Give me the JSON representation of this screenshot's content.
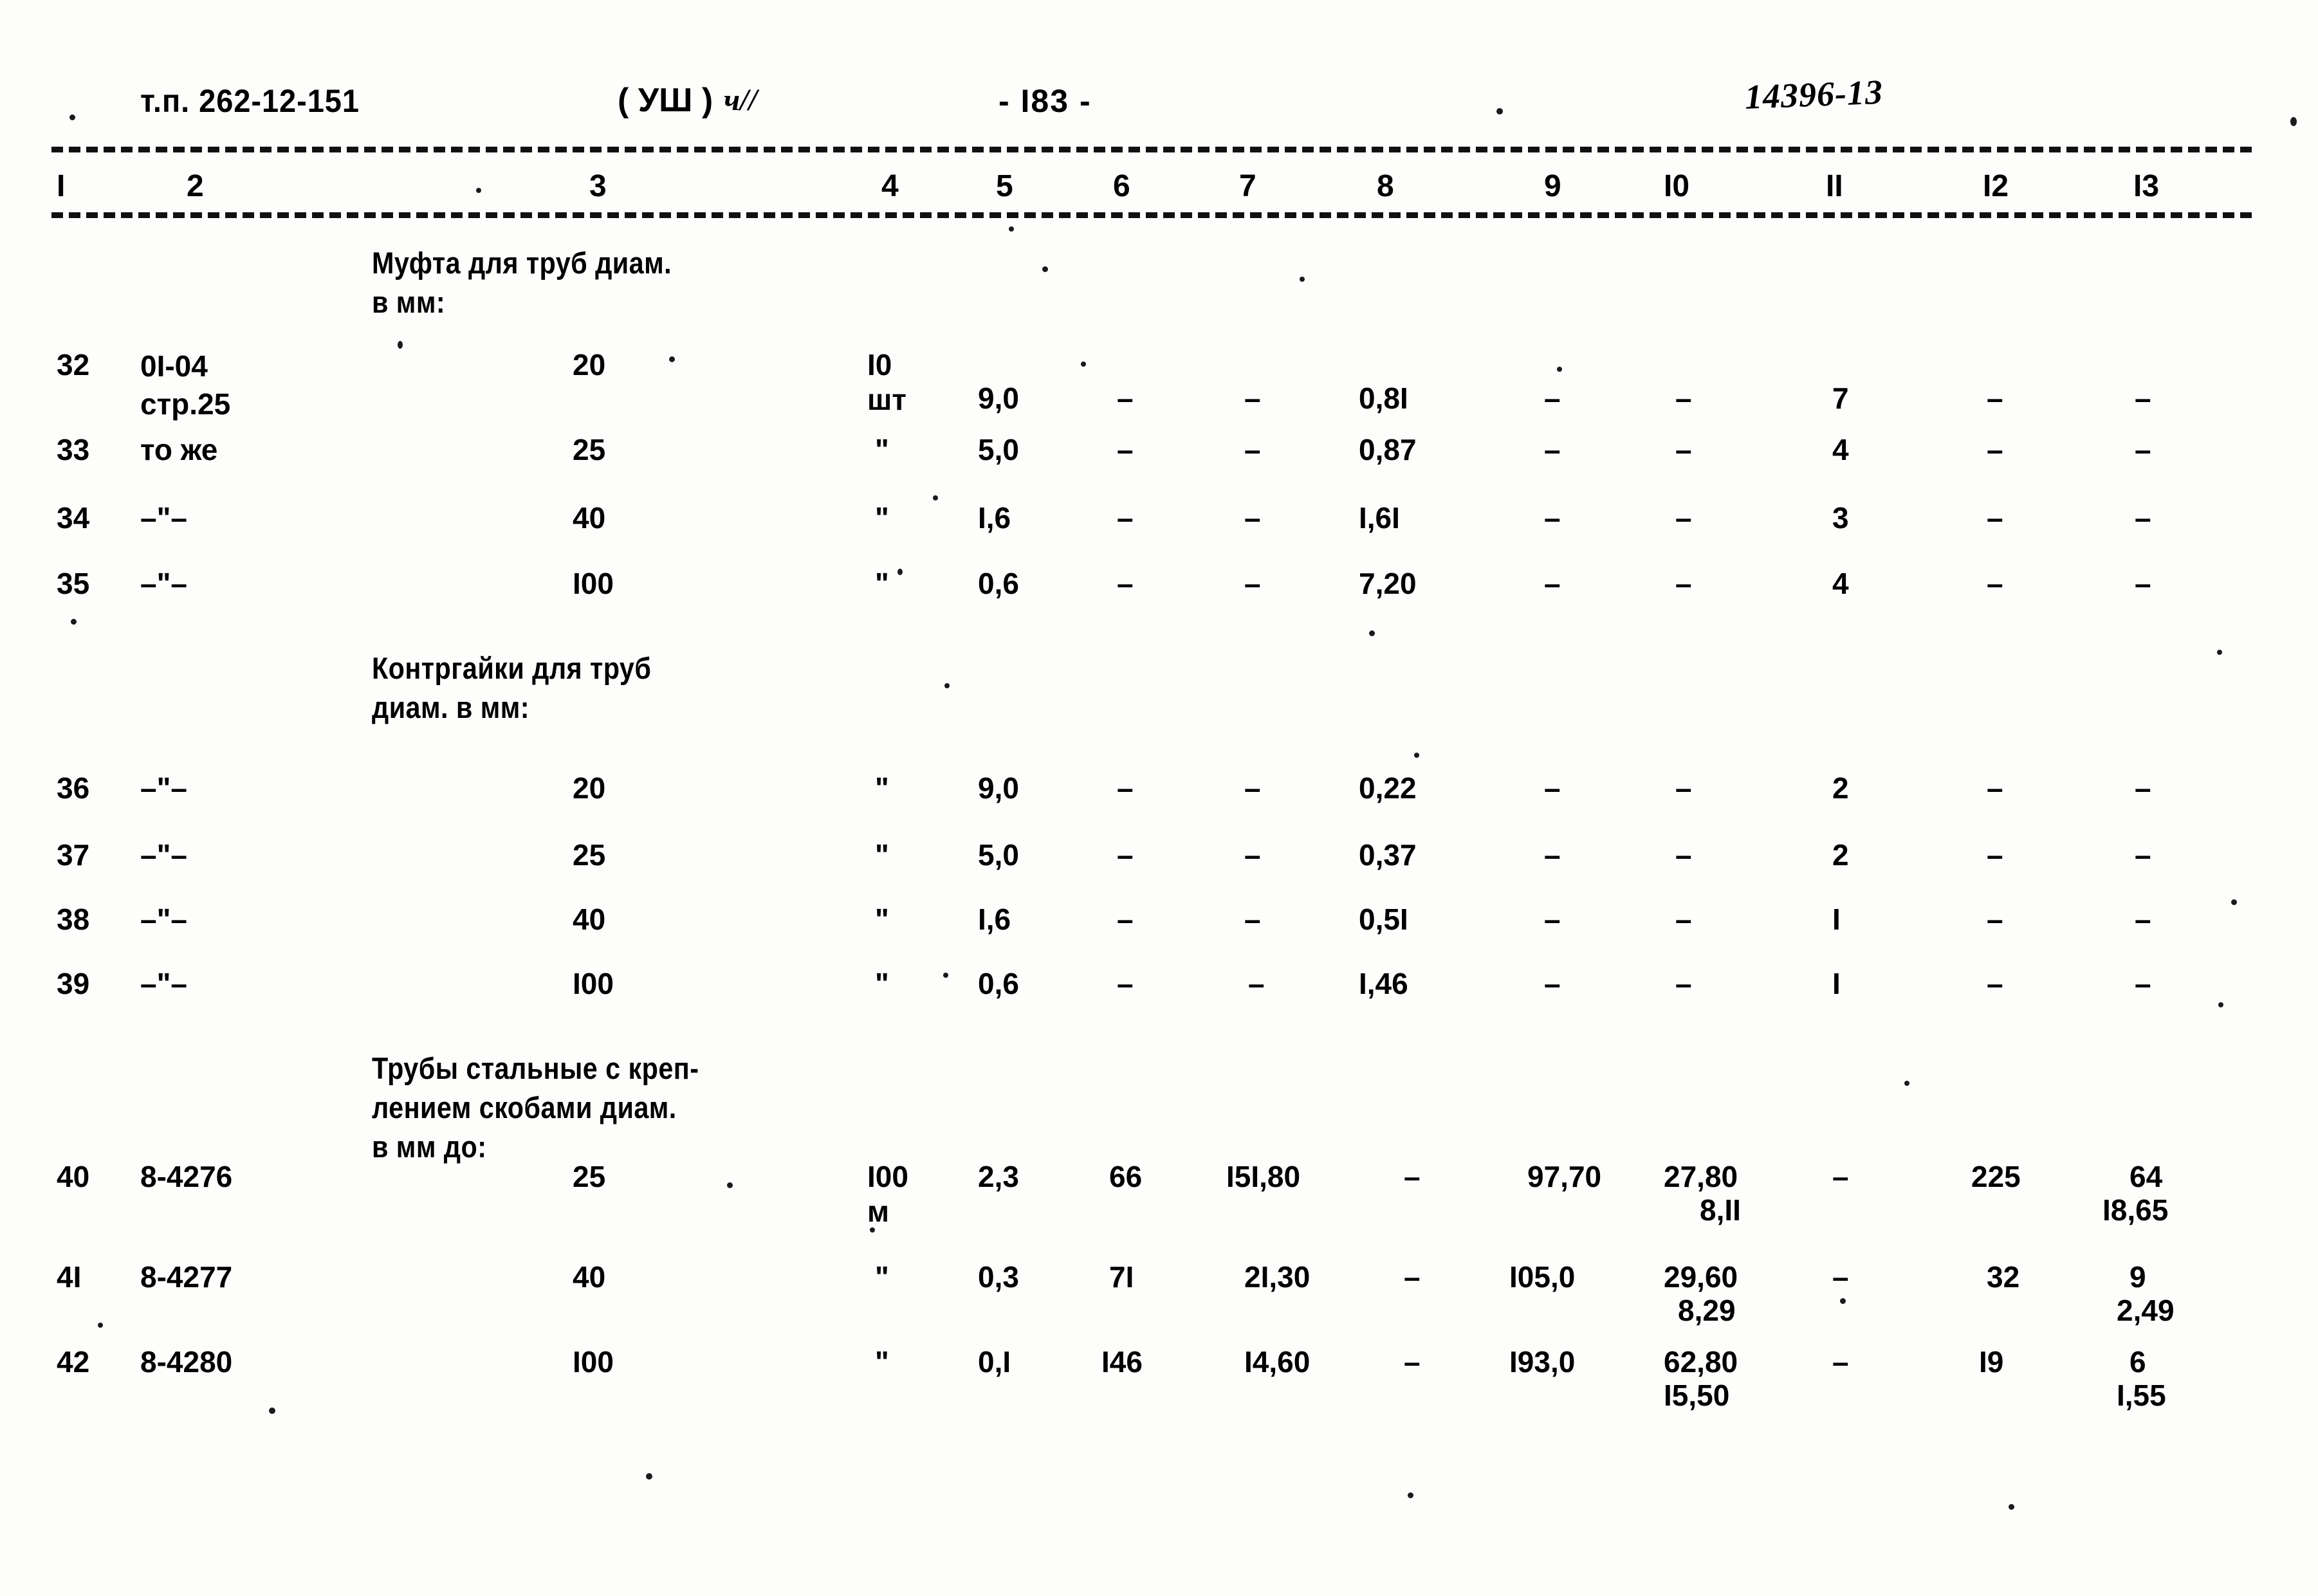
{
  "document": {
    "type_code_label": "т.п. 262-12-151",
    "series_paren": "( УШ )",
    "handwritten_left": "ч//",
    "page_number": "- I83 -",
    "handwritten_right": "14396-13"
  },
  "table": {
    "column_numbers": [
      "I",
      "2",
      "3",
      "4",
      "5",
      "6",
      "7",
      "8",
      "9",
      "I0",
      "II",
      "I2",
      "I3"
    ],
    "sections": [
      {
        "heading": "Муфта для труб диам.\nв мм:",
        "rows": [
          {
            "c1": "32",
            "c2": "0I-04\nстр.25",
            "c3": "20",
            "c4": "I0\nшт",
            "c5": "9,0",
            "c6": "–",
            "c7": "–",
            "c8": "0,8I",
            "c9": "–",
            "c10": "–",
            "c11": "7",
            "c12": "–",
            "c13": "–"
          },
          {
            "c1": "33",
            "c2": "то же",
            "c3": "25",
            "c4": "\"",
            "c5": "5,0",
            "c6": "–",
            "c7": "–",
            "c8": "0,87",
            "c9": "–",
            "c10": "–",
            "c11": "4",
            "c12": "–",
            "c13": "–"
          },
          {
            "c1": "34",
            "c2": "–\"–",
            "c3": "40",
            "c4": "\"",
            "c5": "I,6",
            "c6": "–",
            "c7": "–",
            "c8": "I,6I",
            "c9": "–",
            "c10": "–",
            "c11": "3",
            "c12": "–",
            "c13": "–"
          },
          {
            "c1": "35",
            "c2": "–\"–",
            "c3": "I00",
            "c4": "\"",
            "c5": "0,6",
            "c6": "–",
            "c7": "–",
            "c8": "7,20",
            "c9": "–",
            "c10": "–",
            "c11": "4",
            "c12": "–",
            "c13": "–"
          }
        ]
      },
      {
        "heading": "Контргайки для труб\nдиам. в мм:",
        "rows": [
          {
            "c1": "36",
            "c2": "–\"–",
            "c3": "20",
            "c4": "\"",
            "c5": "9,0",
            "c6": "–",
            "c7": "–",
            "c8": "0,22",
            "c9": "–",
            "c10": "–",
            "c11": "2",
            "c12": "–",
            "c13": "–"
          },
          {
            "c1": "37",
            "c2": "–\"–",
            "c3": "25",
            "c4": "\"",
            "c5": "5,0",
            "c6": "–",
            "c7": "–",
            "c8": "0,37",
            "c9": "–",
            "c10": "–",
            "c11": "2",
            "c12": "–",
            "c13": "–"
          },
          {
            "c1": "38",
            "c2": "–\"–",
            "c3": "40",
            "c4": "\"",
            "c5": "I,6",
            "c6": "–",
            "c7": "–",
            "c8": "0,5I",
            "c9": "–",
            "c10": "–",
            "c11": "I",
            "c12": "–",
            "c13": "–"
          },
          {
            "c1": "39",
            "c2": "–\"–",
            "c3": "I00",
            "c4": "\"",
            "c5": "0,6",
            "c6": "–",
            "c7": "–",
            "c8": "I,46",
            "c9": "–",
            "c10": "–",
            "c11": "I",
            "c12": "–",
            "c13": "–"
          }
        ]
      },
      {
        "heading": "Трубы стальные с креп-\nлением скобами диам.\nв мм до:",
        "rows": [
          {
            "c1": "40",
            "c2": "8-4276",
            "c3": "25",
            "c4": "I00\nм",
            "c5": "2,3",
            "c6": "66",
            "c7": "I5I,80",
            "c8": "–",
            "c9": "97,70",
            "c10": "27,80",
            "c10b": "8,II",
            "c11": "–",
            "c12": "225",
            "c13": "64",
            "c13b": "I8,65"
          },
          {
            "c1": "4I",
            "c2": "8-4277",
            "c3": "40",
            "c4": "\"",
            "c5": "0,3",
            "c6": "7I",
            "c7": "2I,30",
            "c8": "–",
            "c9": "I05,0",
            "c10": "29,60",
            "c10b": "8,29",
            "c11": "–",
            "c12": "32",
            "c13": "9",
            "c13b": "2,49"
          },
          {
            "c1": "42",
            "c2": "8-4280",
            "c3": "I00",
            "c4": "\"",
            "c5": "0,I",
            "c6": "I46",
            "c7": "I4,60",
            "c8": "–",
            "c9": "I93,0",
            "c10": "62,80",
            "c10b": "I5,50",
            "c11": "–",
            "c12": "I9",
            "c13": "6",
            "c13b": "I,55"
          }
        ]
      }
    ]
  }
}
